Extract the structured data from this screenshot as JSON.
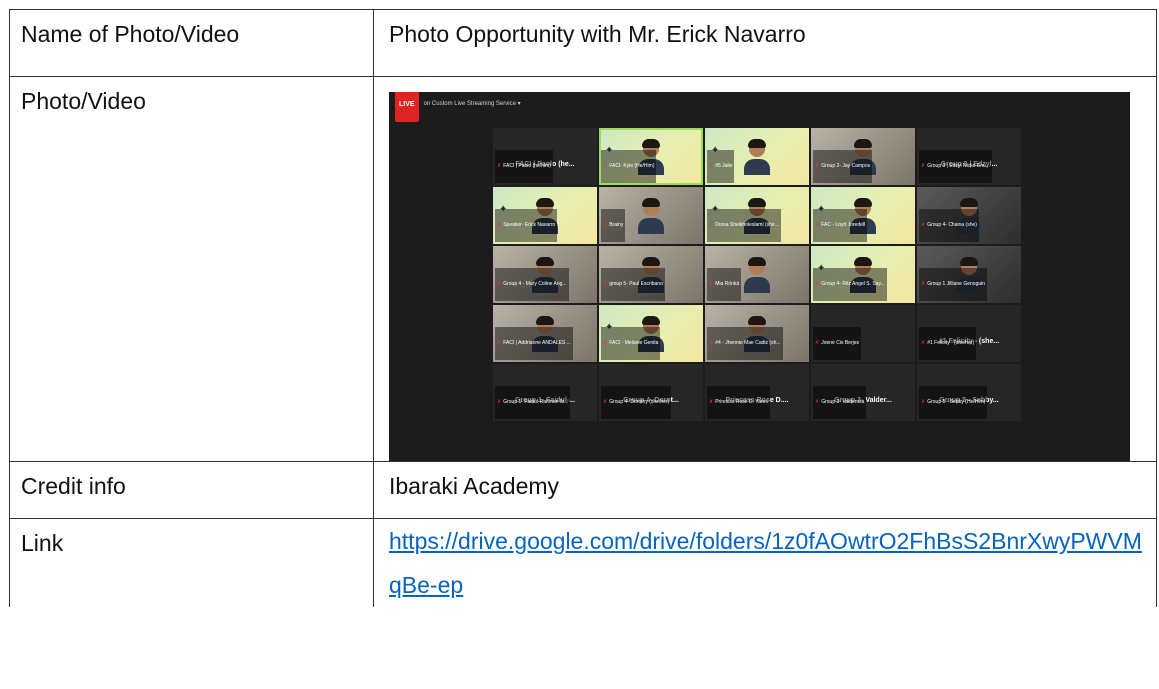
{
  "rows": {
    "name": {
      "label": "Name of Photo/Video",
      "value": "Photo Opportunity with Mr. Erick Navarro"
    },
    "photo": {
      "label": "Photo/Video"
    },
    "credit": {
      "label": "Credit info",
      "value": "Ibaraki Academy"
    },
    "link": {
      "label": "Link",
      "value": "https://drive.google.com/drive/folders/1z0fAOwtrO2FhBsS2BnrXwyPWVMqBe-ep"
    }
  },
  "screenshot": {
    "live_label": "LIVE",
    "stream_text": "on Custom Live Streaming Service ▾",
    "tiles": [
      {
        "kind": "name",
        "big": "FACI | Paolo (he...",
        "cap": "FACI | Paolo (he/him)"
      },
      {
        "kind": "video",
        "cap": "FACI- Kyle (He/Him)",
        "active": true
      },
      {
        "kind": "video",
        "cap": "#5 Jaile"
      },
      {
        "kind": "indoor",
        "cap": "Group 2- Jay Campos"
      },
      {
        "kind": "name",
        "big": "Group 3 | Edzyl...",
        "cap": "Group 3 | Edzyl Nicko Enu..."
      },
      {
        "kind": "video",
        "cap": "Speaker- Erick Navarro"
      },
      {
        "kind": "indoor",
        "cap": "Brainy"
      },
      {
        "kind": "video",
        "cap": "Dorsa Sheikholeslami (she..."
      },
      {
        "kind": "video",
        "cap": "FAC - Loyd Joredell"
      },
      {
        "kind": "dark",
        "cap": "Group 4- Chaina (she)"
      },
      {
        "kind": "indoor",
        "cap": "Group 4 - Mary Coline Ang..."
      },
      {
        "kind": "indoor",
        "cap": "group 5- Paul Escribano"
      },
      {
        "kind": "indoor",
        "cap": "Mia Rönkä"
      },
      {
        "kind": "video",
        "cap": "Group 4- Ritz Angel S. Say..."
      },
      {
        "kind": "dark",
        "cap": "Group 1 Jilliane Genoguin"
      },
      {
        "kind": "indoor",
        "cap": "FACI | Addrianne ANDALES ..."
      },
      {
        "kind": "video",
        "cap": "FACI - Melanie Genita"
      },
      {
        "kind": "indoor",
        "cap": "#4 - Jhennie Mae Cadiz (sh..."
      },
      {
        "kind": "blank",
        "cap": "Joene Cis Berjes"
      },
      {
        "kind": "name",
        "big": "#1 Felicity - (she...",
        "cap": "#1 Felicity - (she/her)"
      },
      {
        "kind": "name",
        "big": "Group 1- Faidul-...",
        "cap": "Group 1- Faidul-Rahman Ib..."
      },
      {
        "kind": "name",
        "big": "Group 4- Dorot...",
        "cap": "Group 4- Dorothy (she/her)"
      },
      {
        "kind": "name",
        "big": "Princess Rose D....",
        "cap": "Princess Rose D. Yares"
      },
      {
        "kind": "name",
        "big": "Group 3- Valder...",
        "cap": "Group 3- Valderosa"
      },
      {
        "kind": "name",
        "big": "Group 5 - Sebby...",
        "cap": "Group 5 - Sebby (He/Him)"
      }
    ]
  }
}
